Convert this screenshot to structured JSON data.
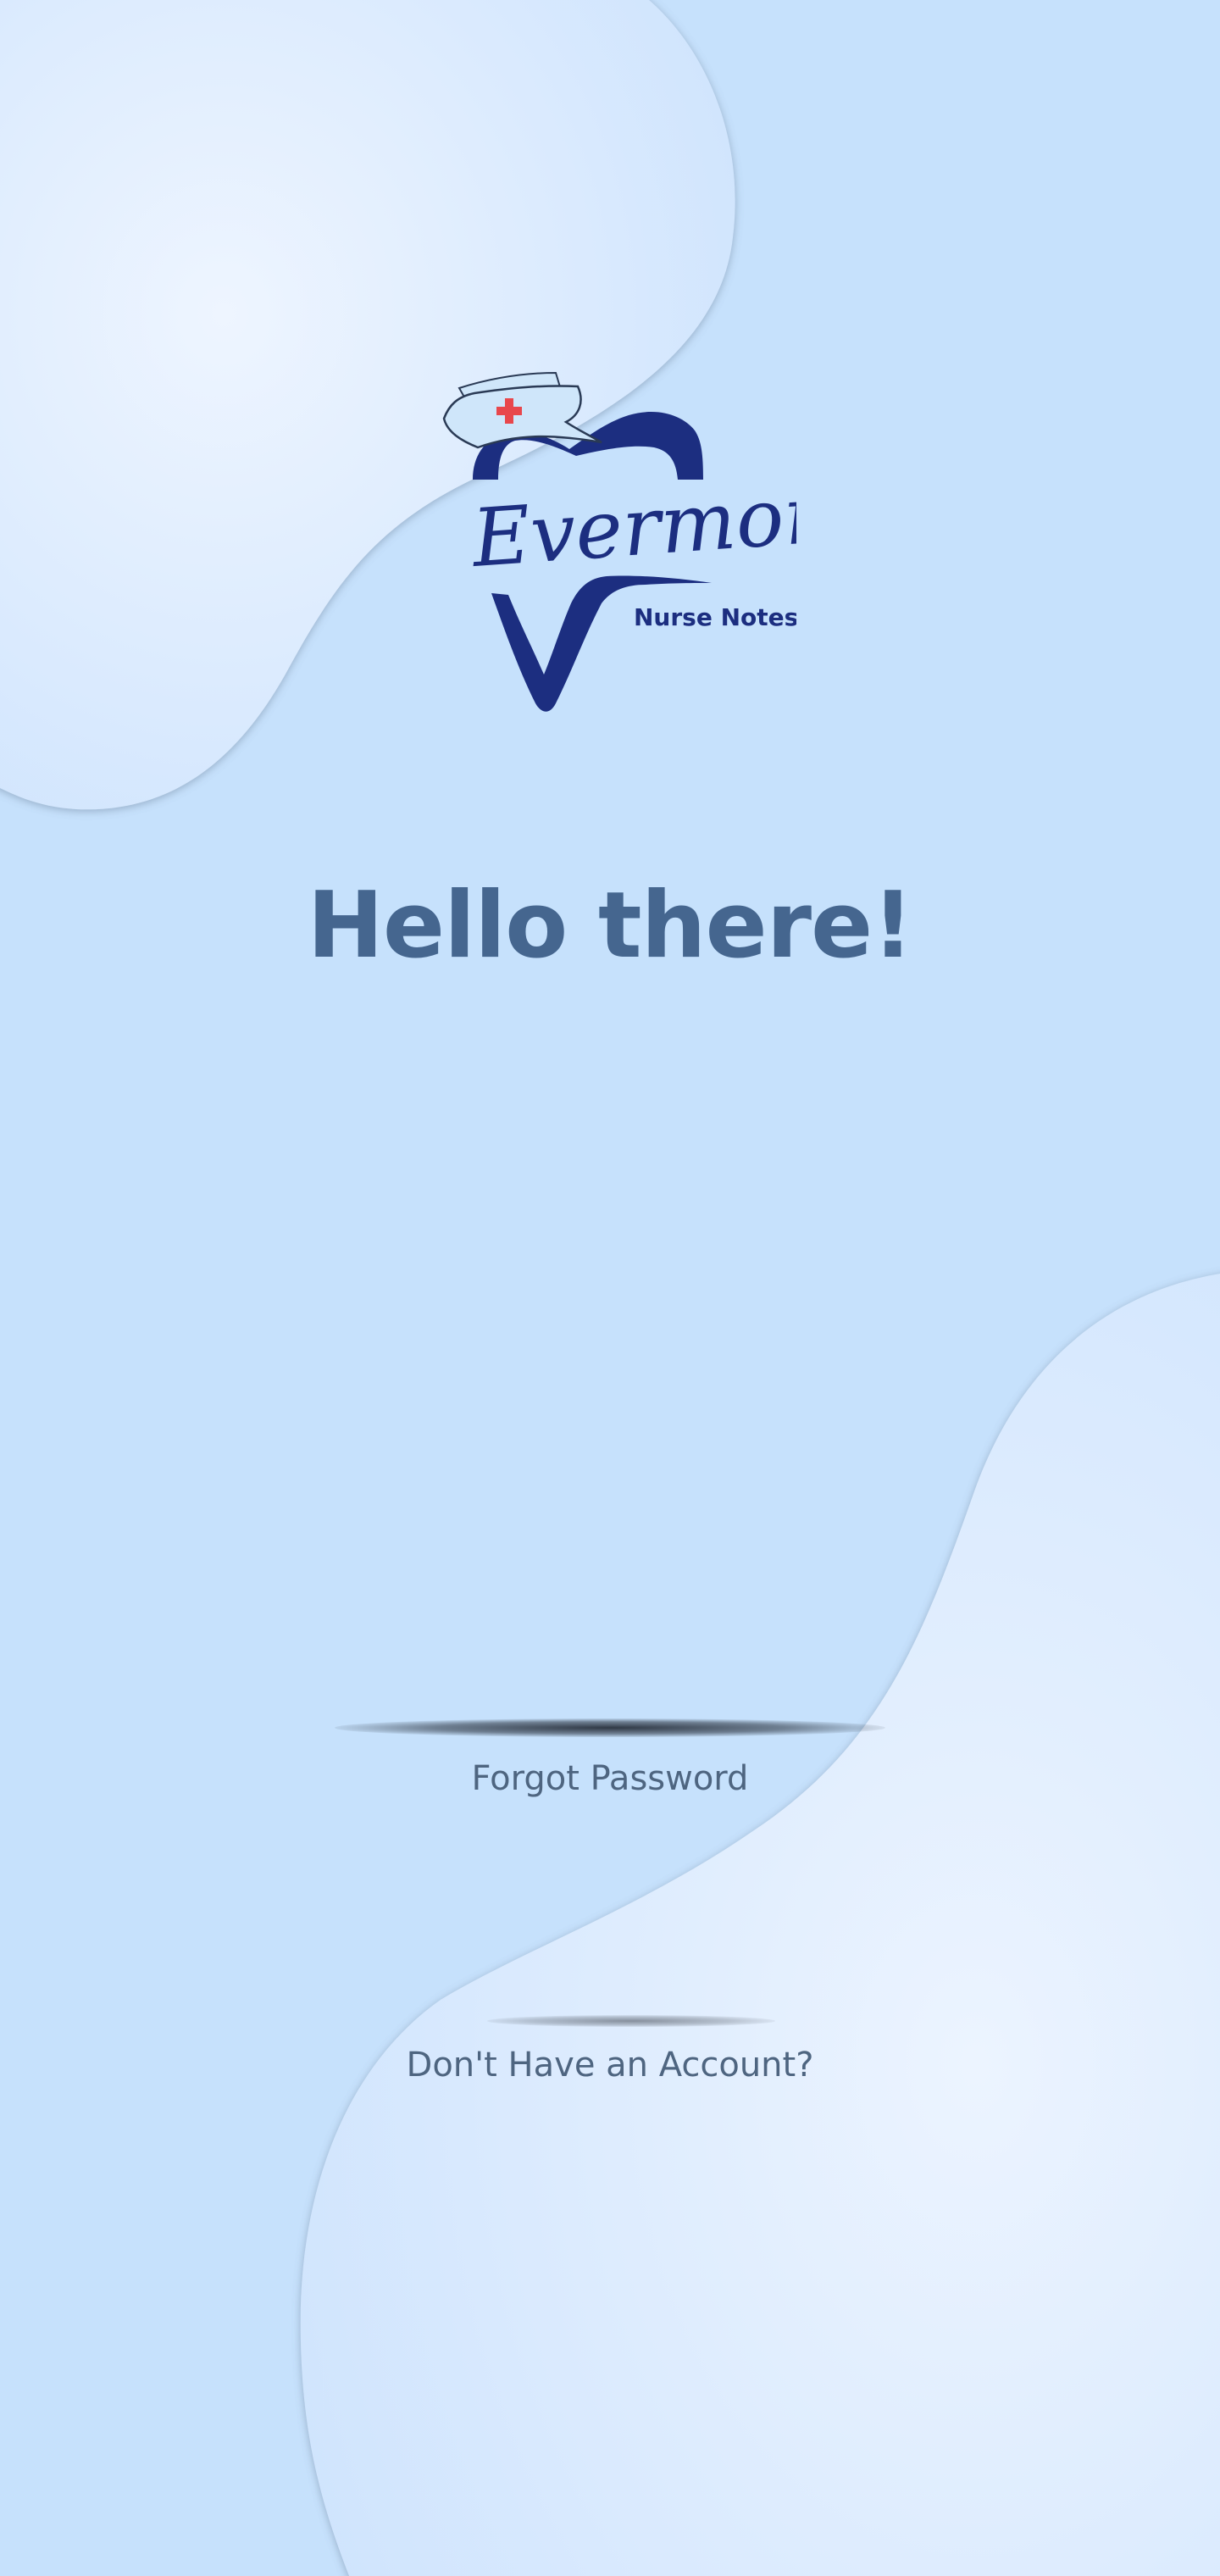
{
  "brand": {
    "name": "Evermore",
    "tagline": "Nurse Notes"
  },
  "greeting": "Hello there!",
  "links": {
    "forgot_password": "Forgot Password",
    "signup": "Don't Have an Account?"
  },
  "colors": {
    "background": "#c6e1fc",
    "blob_light": "#eef5ff",
    "brand_navy": "#1c2e80",
    "cross_red": "#e8474c",
    "heading": "#45668f",
    "link_text": "#4e6580"
  },
  "icons": {
    "logo_mark": "tooth-with-nurse-cap-icon",
    "cap_cross": "medical-cross-icon"
  }
}
